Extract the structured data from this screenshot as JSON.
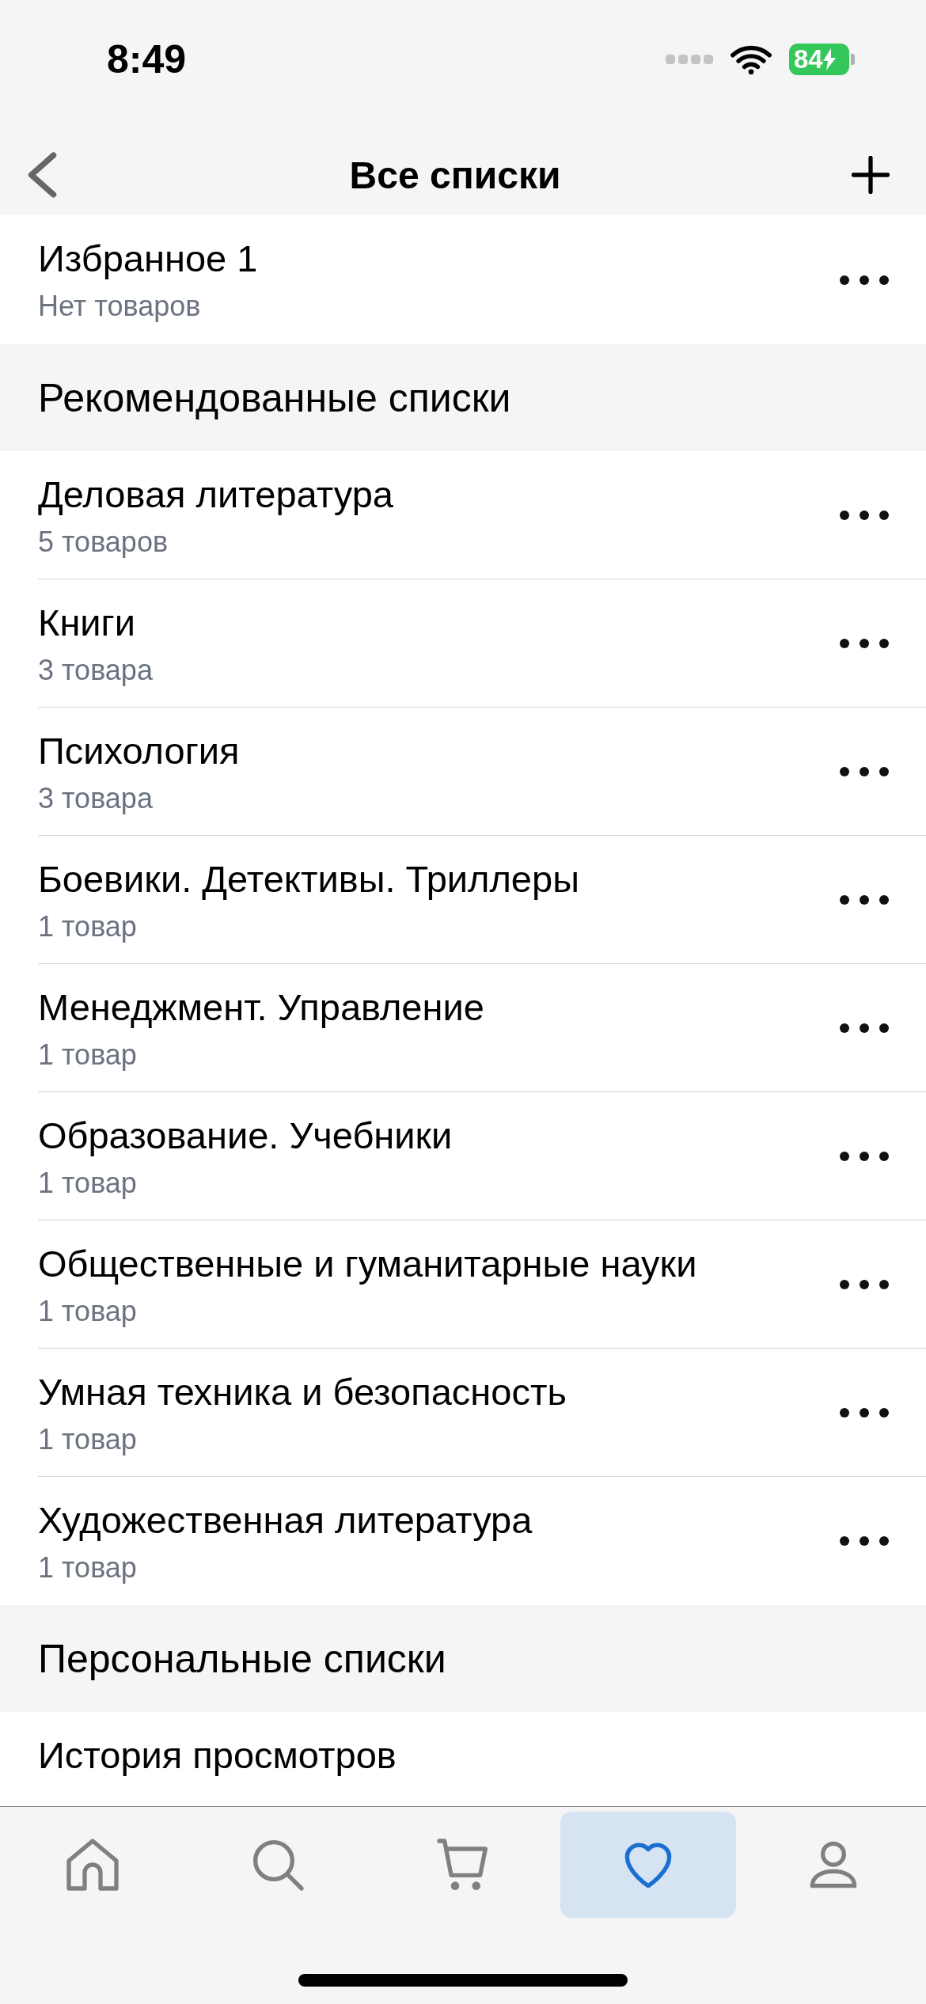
{
  "status_bar": {
    "time": "8:49",
    "battery_text": "84"
  },
  "header": {
    "title": "Все списки"
  },
  "favorites": [
    {
      "title": "Избранное 1",
      "subtitle": "Нет товаров"
    }
  ],
  "sections": [
    {
      "title": "Рекомендованные списки",
      "items": [
        {
          "title": "Деловая литература",
          "subtitle": "5 товаров"
        },
        {
          "title": "Книги",
          "subtitle": "3 товара"
        },
        {
          "title": "Психология",
          "subtitle": "3 товара"
        },
        {
          "title": "Боевики. Детективы. Триллеры",
          "subtitle": "1 товар"
        },
        {
          "title": "Менеджмент. Управление",
          "subtitle": "1 товар"
        },
        {
          "title": "Образование. Учебники",
          "subtitle": "1 товар"
        },
        {
          "title": "Общественные и гуманитарные науки",
          "subtitle": "1 товар"
        },
        {
          "title": "Умная техника и безопасность",
          "subtitle": "1 товар"
        },
        {
          "title": "Художественная литература",
          "subtitle": "1 товар"
        }
      ]
    },
    {
      "title": "Персональные списки",
      "items": [
        {
          "title": "История просмотров"
        }
      ]
    }
  ],
  "tab_bar": [
    {
      "kind": "home",
      "selected": false
    },
    {
      "kind": "search",
      "selected": false
    },
    {
      "kind": "cart",
      "selected": false
    },
    {
      "kind": "favorites",
      "selected": true
    },
    {
      "kind": "profile",
      "selected": false
    }
  ]
}
